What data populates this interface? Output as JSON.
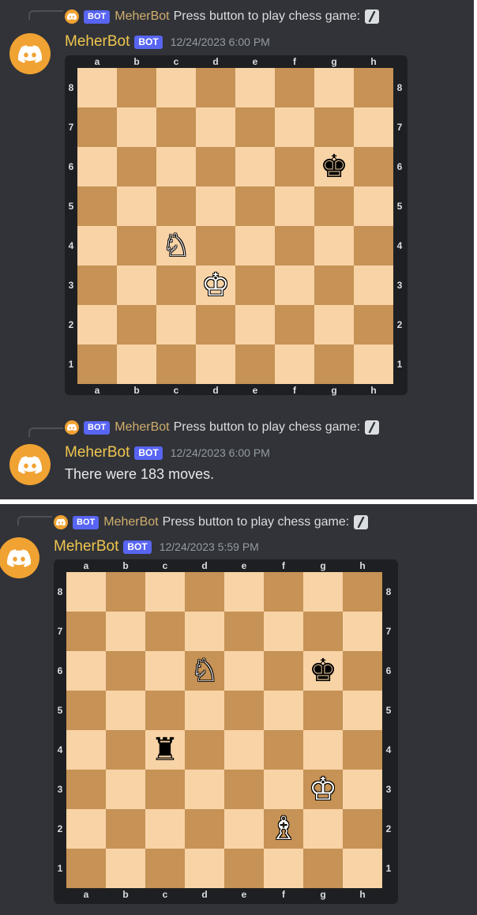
{
  "colors": {
    "background": "#313338",
    "author_name": "#f0c64f",
    "bot_tag": "#5865f2",
    "avatar": "#f0a232",
    "light_square": "#f8d3a6",
    "dark_square": "#c69255"
  },
  "messages": [
    {
      "reply": {
        "author": "MeherBot",
        "bot_tag": "BOT",
        "text": "Press button to play chess game:",
        "icon": "slash-command-icon"
      },
      "author": "MeherBot",
      "bot_tag": "BOT",
      "timestamp": "12/24/2023 6:00 PM",
      "avatar_icon": "discord-logo-icon",
      "board": {
        "files": [
          "a",
          "b",
          "c",
          "d",
          "e",
          "f",
          "g",
          "h"
        ],
        "ranks": [
          "8",
          "7",
          "6",
          "5",
          "4",
          "3",
          "2",
          "1"
        ],
        "pieces": [
          {
            "square": "g6",
            "glyph": "♚",
            "color": "black",
            "name": "black-king"
          },
          {
            "square": "c4",
            "glyph": "♘",
            "color": "white",
            "name": "white-knight"
          },
          {
            "square": "d3",
            "glyph": "♔",
            "color": "white",
            "name": "white-king"
          }
        ]
      }
    },
    {
      "reply": {
        "author": "MeherBot",
        "bot_tag": "BOT",
        "text": "Press button to play chess game:",
        "icon": "slash-command-icon"
      },
      "author": "MeherBot",
      "bot_tag": "BOT",
      "timestamp": "12/24/2023 6:00 PM",
      "avatar_icon": "discord-logo-icon",
      "text": "There were 183 moves."
    },
    {
      "reply": {
        "author": "MeherBot",
        "bot_tag": "BOT",
        "text": "Press button to play chess game:",
        "icon": "slash-command-icon"
      },
      "author": "MeherBot",
      "bot_tag": "BOT",
      "timestamp": "12/24/2023 5:59 PM",
      "avatar_icon": "discord-logo-icon",
      "board": {
        "files": [
          "a",
          "b",
          "c",
          "d",
          "e",
          "f",
          "g",
          "h"
        ],
        "ranks": [
          "8",
          "7",
          "6",
          "5",
          "4",
          "3",
          "2",
          "1"
        ],
        "pieces": [
          {
            "square": "d6",
            "glyph": "♘",
            "color": "white",
            "name": "white-knight"
          },
          {
            "square": "g6",
            "glyph": "♚",
            "color": "black",
            "name": "black-king"
          },
          {
            "square": "c4",
            "glyph": "♜",
            "color": "black",
            "name": "black-rook"
          },
          {
            "square": "g3",
            "glyph": "♔",
            "color": "white",
            "name": "white-king"
          },
          {
            "square": "f2",
            "glyph": "♗",
            "color": "white",
            "name": "white-bishop"
          }
        ]
      }
    }
  ]
}
